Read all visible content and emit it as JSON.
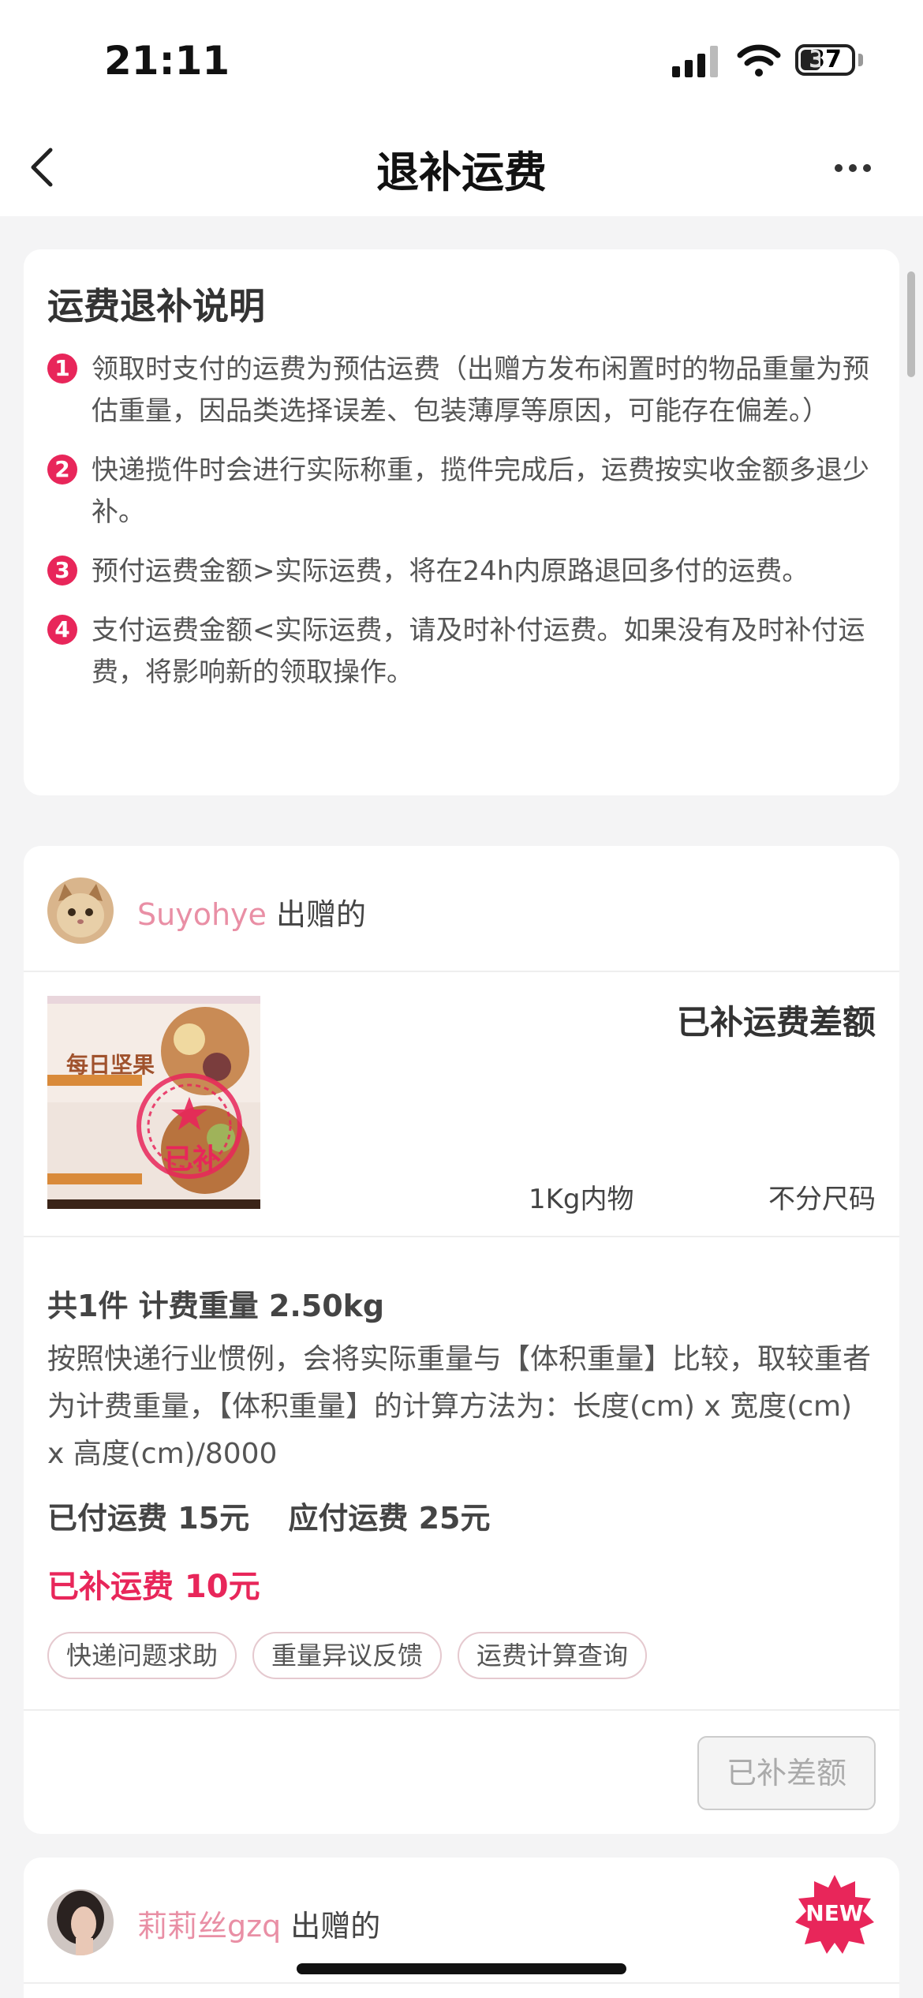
{
  "status_bar": {
    "time": "21:11",
    "battery_level": "37",
    "battery_fraction": 0.37
  },
  "nav": {
    "title": "退补运费"
  },
  "info": {
    "title": "运费退补说明",
    "rules": [
      {
        "num": "1",
        "text": "领取时支付的运费为预估运费（出赠方发布闲置时的物品重量为预估重量，因品类选择误差、包装薄厚等原因，可能存在偏差。）"
      },
      {
        "num": "2",
        "text": "快递揽件时会进行实际称重，揽件完成后，运费按实收金额多退少补。"
      },
      {
        "num": "3",
        "text": "预付运费金额>实际运费，将在24h内原路退回多付的运费。"
      },
      {
        "num": "4",
        "text": "支付运费金额<实际运费，请及时补付运费。如果没有及时补付运费，将影响新的领取操作。"
      }
    ]
  },
  "order1": {
    "donor_name": "Suyohye",
    "donor_suffix": "出赠的",
    "status": "已补运费差额",
    "product_image_text": "每日坚果",
    "stamp_text": "已补",
    "spec1": "1Kg内物",
    "spec2": "不分尺码",
    "weight": "共1件 计费重量 2.50kg",
    "explain": "按照快递行业惯例，会将实际重量与【体积重量】比较，取较重者为计费重量，【体积重量】的计算方法为：长度(cm) x 宽度(cm) x 高度(cm)/8000",
    "paid": "已付运费 15元",
    "due": "应付运费 25元",
    "refund": "已补运费 10元",
    "chips": [
      "快递问题求助",
      "重量异议反馈",
      "运费计算查询"
    ],
    "button": "已补差额"
  },
  "order2": {
    "donor_name": "莉莉丝gzq",
    "donor_suffix": "出赠的",
    "badge": "NEW"
  },
  "colors": {
    "accent": "#e8265a",
    "donor_name": "#e98fa5",
    "background": "#f4f4f5"
  }
}
